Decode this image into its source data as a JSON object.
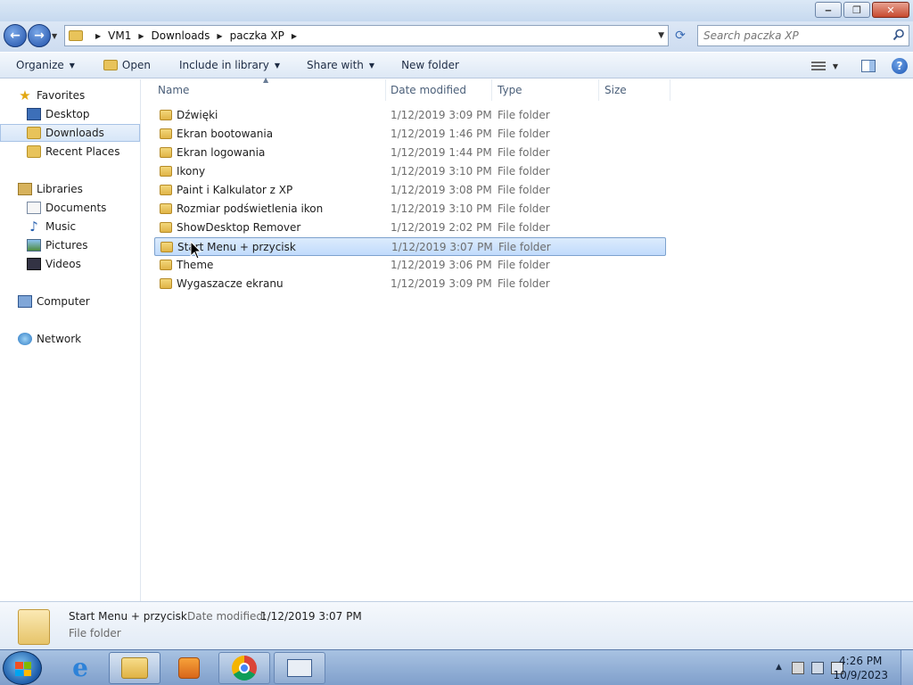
{
  "titlebar": {
    "buttons": [
      {
        "name": "minimize",
        "glyph": "‒"
      },
      {
        "name": "maximize",
        "glyph": "❐"
      },
      {
        "name": "close",
        "glyph": "✕"
      }
    ]
  },
  "nav": {
    "back_glyph": "←",
    "forward_glyph": "→",
    "breadcrumb": [
      "VM1",
      "Downloads",
      "paczka XP"
    ],
    "search_placeholder": "Search paczka XP",
    "refresh_glyph": "⟳"
  },
  "toolbar": {
    "organize": "Organize",
    "open": "Open",
    "include_in_library": "Include in library",
    "share_with": "Share with",
    "new_folder": "New folder",
    "help_glyph": "?"
  },
  "sidebar": {
    "favorites": "Favorites",
    "desktop": "Desktop",
    "downloads": "Downloads",
    "recent_places": "Recent Places",
    "libraries": "Libraries",
    "documents": "Documents",
    "music": "Music",
    "pictures": "Pictures",
    "videos": "Videos",
    "computer": "Computer",
    "network": "Network",
    "star_glyph": "★",
    "note_glyph": "♪"
  },
  "columns": {
    "name": "Name",
    "date_modified": "Date modified",
    "type": "Type",
    "size": "Size"
  },
  "files": [
    {
      "name": "Dźwięki",
      "date": "1/12/2019 3:09 PM",
      "type": "File folder"
    },
    {
      "name": "Ekran bootowania",
      "date": "1/12/2019 1:46 PM",
      "type": "File folder"
    },
    {
      "name": "Ekran logowania",
      "date": "1/12/2019 1:44 PM",
      "type": "File folder"
    },
    {
      "name": "Ikony",
      "date": "1/12/2019 3:10 PM",
      "type": "File folder"
    },
    {
      "name": "Paint i Kalkulator z XP",
      "date": "1/12/2019 3:08 PM",
      "type": "File folder"
    },
    {
      "name": "Rozmiar podświetlenia ikon",
      "date": "1/12/2019 3:10 PM",
      "type": "File folder"
    },
    {
      "name": "ShowDesktop Remover",
      "date": "1/12/2019 2:02 PM",
      "type": "File folder"
    },
    {
      "name": "Start Menu + przycisk",
      "date": "1/12/2019 3:07 PM",
      "type": "File folder",
      "selected": true
    },
    {
      "name": "Theme",
      "date": "1/12/2019 3:06 PM",
      "type": "File folder"
    },
    {
      "name": "Wygaszacze ekranu",
      "date": "1/12/2019 3:09 PM",
      "type": "File folder"
    }
  ],
  "details": {
    "name": "Start Menu + przycisk",
    "date_label": "Date modified:",
    "date_value": "1/12/2019 3:07 PM",
    "type": "File folder"
  },
  "taskbar": {
    "clock_time": "4:26 PM",
    "clock_date": "10/9/2023",
    "tray_up_glyph": "▲",
    "ie_glyph": "e"
  },
  "colors": {
    "accent": "#3d6fb8",
    "selection": "#c1dbfc"
  }
}
